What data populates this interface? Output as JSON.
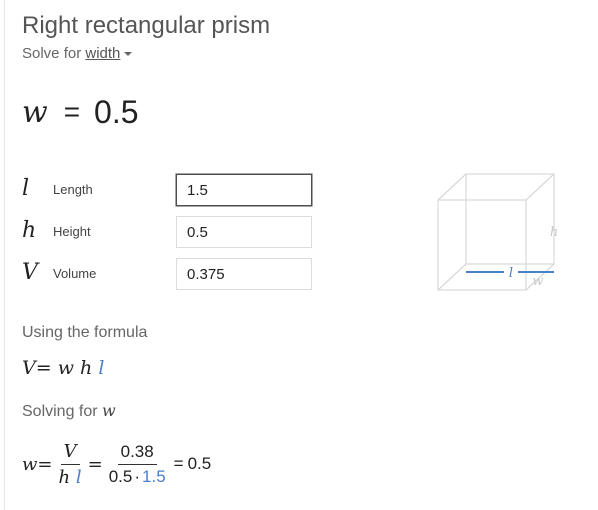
{
  "title": "Right rectangular prism",
  "solve_for": {
    "prefix": "Solve for",
    "selected": "width"
  },
  "result": {
    "symbol": "w",
    "equals": "=",
    "value": "0.5"
  },
  "inputs": [
    {
      "symbol": "l",
      "label": "Length",
      "value": "1.5"
    },
    {
      "symbol": "h",
      "label": "Height",
      "value": "0.5"
    },
    {
      "symbol": "V",
      "label": "Volume",
      "value": "0.375"
    }
  ],
  "diagram": {
    "height_label": "h",
    "length_label": "l",
    "width_label": "w"
  },
  "formula_heading": "Using the formula",
  "formula": {
    "lhs": "V",
    "eq": "=",
    "w": "w",
    "h": "h",
    "l": "l"
  },
  "solving_for": {
    "prefix": "Solving for",
    "symbol": "w"
  },
  "solution": {
    "lhs": "w",
    "eq": "=",
    "frac1_num": "V",
    "frac1_den_h": "h",
    "frac1_den_l": "l",
    "frac2_num": "0.38",
    "frac2_den_a": "0.5",
    "frac2_den_dot": "·",
    "frac2_den_b": "1.5",
    "eq2": "=",
    "result": "0.5"
  },
  "colors": {
    "accent_blue": "#4a7fc9",
    "diagram_line": "#d8d8d8"
  }
}
